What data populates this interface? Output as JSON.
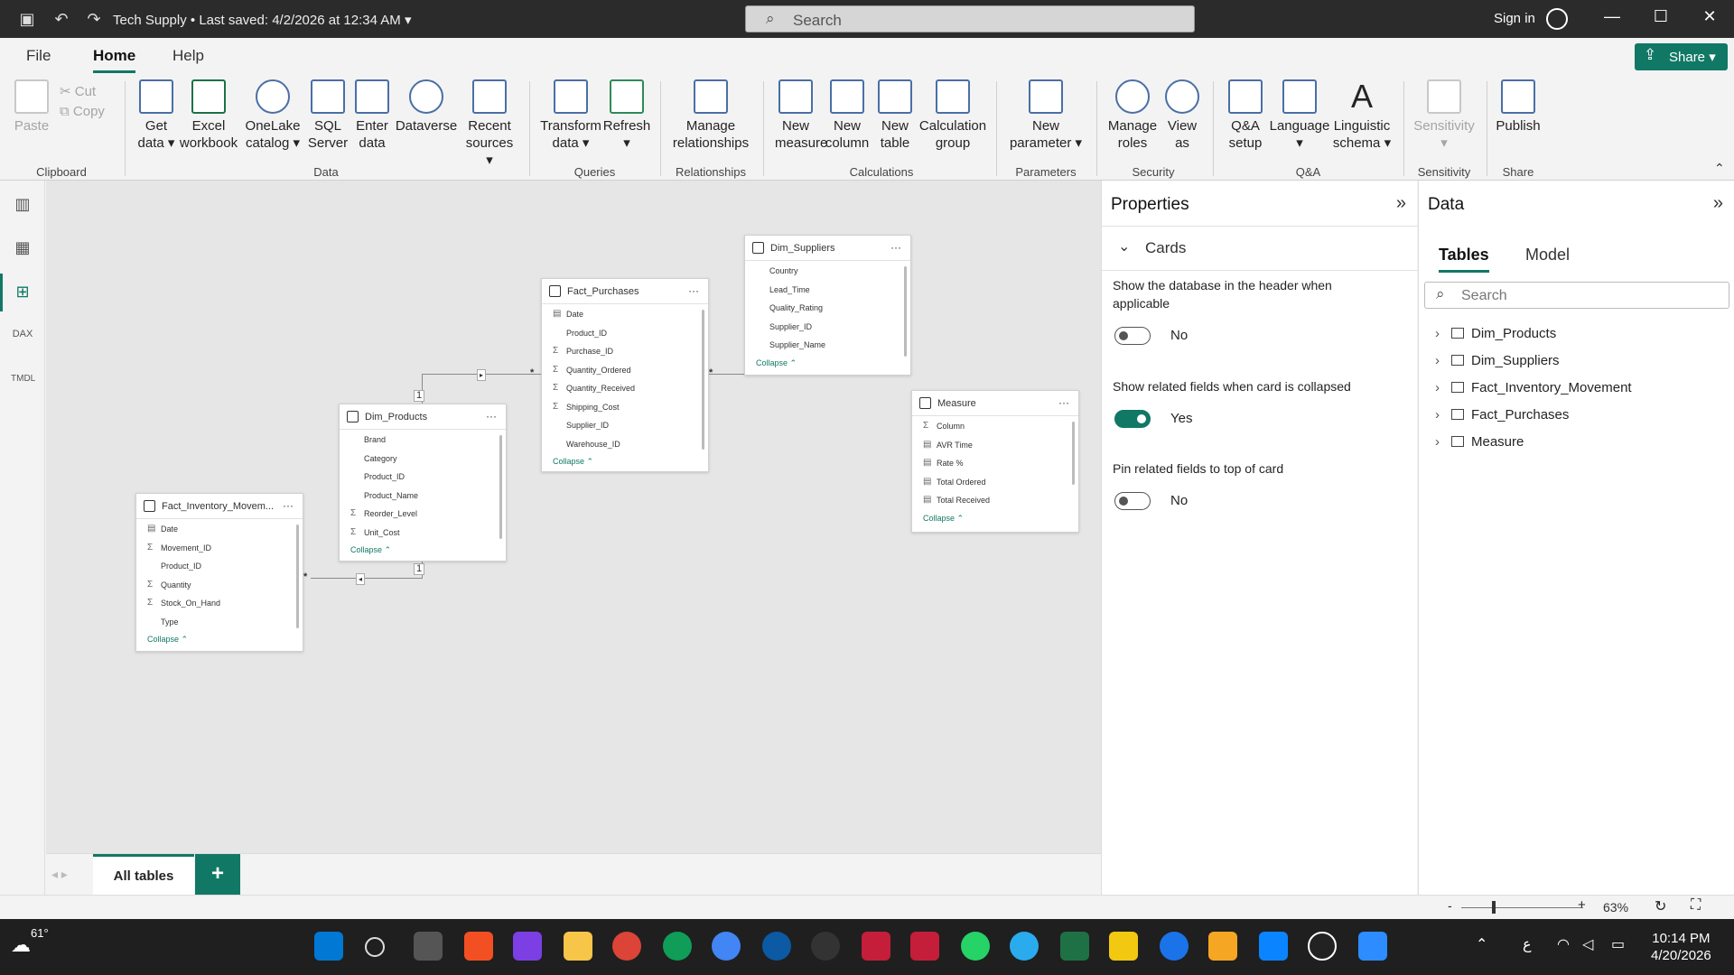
{
  "titlebar": {
    "title": "Tech Supply",
    "saved": "Last saved: 4/2/2026 at 12:34 AM",
    "search_placeholder": "Search",
    "signin": "Sign in"
  },
  "menu": {
    "file": "File",
    "home": "Home",
    "help": "Help",
    "share": "Share"
  },
  "ribbon": {
    "paste": "Paste",
    "cut": "Cut",
    "copy": "Copy",
    "clipboard": "Clipboard",
    "get_data_1": "Get",
    "get_data_2": "data",
    "excel_1": "Excel",
    "excel_2": "workbook",
    "onelake_1": "OneLake",
    "onelake_2": "catalog",
    "sql_1": "SQL",
    "sql_2": "Server",
    "enter_1": "Enter",
    "enter_2": "data",
    "dataverse": "Dataverse",
    "recent_1": "Recent",
    "recent_2": "sources",
    "data_group": "Data",
    "transform_1": "Transform",
    "transform_2": "data",
    "refresh": "Refresh",
    "queries_group": "Queries",
    "manage_rel_1": "Manage",
    "manage_rel_2": "relationships",
    "relationships_group": "Relationships",
    "new_measure_1": "New",
    "new_measure_2": "measure",
    "new_column_1": "New",
    "new_column_2": "column",
    "new_table_1": "New",
    "new_table_2": "table",
    "calc_group_1": "Calculation",
    "calc_group_2": "group",
    "calculations_group": "Calculations",
    "new_param_1": "New",
    "new_param_2": "parameter",
    "parameters_group": "Parameters",
    "manage_roles_1": "Manage",
    "manage_roles_2": "roles",
    "view_as_1": "View",
    "view_as_2": "as",
    "security_group": "Security",
    "qa_setup_1": "Q&A",
    "qa_setup_2": "setup",
    "language": "Language",
    "linguistic_1": "Linguistic",
    "linguistic_2": "schema",
    "qa_group": "Q&A",
    "sensitivity": "Sensitivity",
    "sensitivity_group": "Sensitivity",
    "publish": "Publish",
    "share_group": "Share"
  },
  "cards": {
    "suppliers": {
      "title": "Dim_Suppliers",
      "fields": [
        "Country",
        "Lead_Time",
        "Quality_Rating",
        "Supplier_ID",
        "Supplier_Name"
      ],
      "collapse": "Collapse"
    },
    "purchases": {
      "title": "Fact_Purchases",
      "fields": [
        "Date",
        "Product_ID",
        "Purchase_ID",
        "Quantity_Ordered",
        "Quantity_Received",
        "Shipping_Cost",
        "Supplier_ID",
        "Warehouse_ID"
      ],
      "collapse": "Collapse"
    },
    "products": {
      "title": "Dim_Products",
      "fields": [
        "Brand",
        "Category",
        "Product_ID",
        "Product_Name",
        "Reorder_Level",
        "Unit_Cost"
      ],
      "collapse": "Collapse"
    },
    "inventory": {
      "title": "Fact_Inventory_Movem...",
      "fields": [
        "Date",
        "Movement_ID",
        "Product_ID",
        "Quantity",
        "Stock_On_Hand",
        "Type"
      ],
      "collapse": "Collapse"
    },
    "measure": {
      "title": "Measure",
      "fields": [
        "Column",
        "AVR Time",
        "Rate %",
        "Total Ordered",
        "Total Received"
      ],
      "collapse": "Collapse"
    }
  },
  "rel": {
    "one": "1",
    "many": "*"
  },
  "tabs": {
    "all_tables": "All tables",
    "add": "+"
  },
  "properties": {
    "title": "Properties",
    "section": "Cards",
    "opt1": "Show the database in the header when applicable",
    "opt1_value": "No",
    "opt2": "Show related fields when card is collapsed",
    "opt2_value": "Yes",
    "opt3": "Pin related fields to top of card",
    "opt3_value": "No"
  },
  "data_panel": {
    "title": "Data",
    "tab_tables": "Tables",
    "tab_model": "Model",
    "search_placeholder": "Search",
    "tables": [
      "Dim_Products",
      "Dim_Suppliers",
      "Fact_Inventory_Movement",
      "Fact_Purchases",
      "Measure"
    ]
  },
  "status": {
    "zoom": "63%"
  },
  "taskbar": {
    "temp": "61°",
    "time": "10:14 PM",
    "date": "4/20/2026"
  },
  "colors": {
    "accent": "#117865",
    "titlebar": "#2b2b2b",
    "taskbar": "#1f1f1f"
  }
}
